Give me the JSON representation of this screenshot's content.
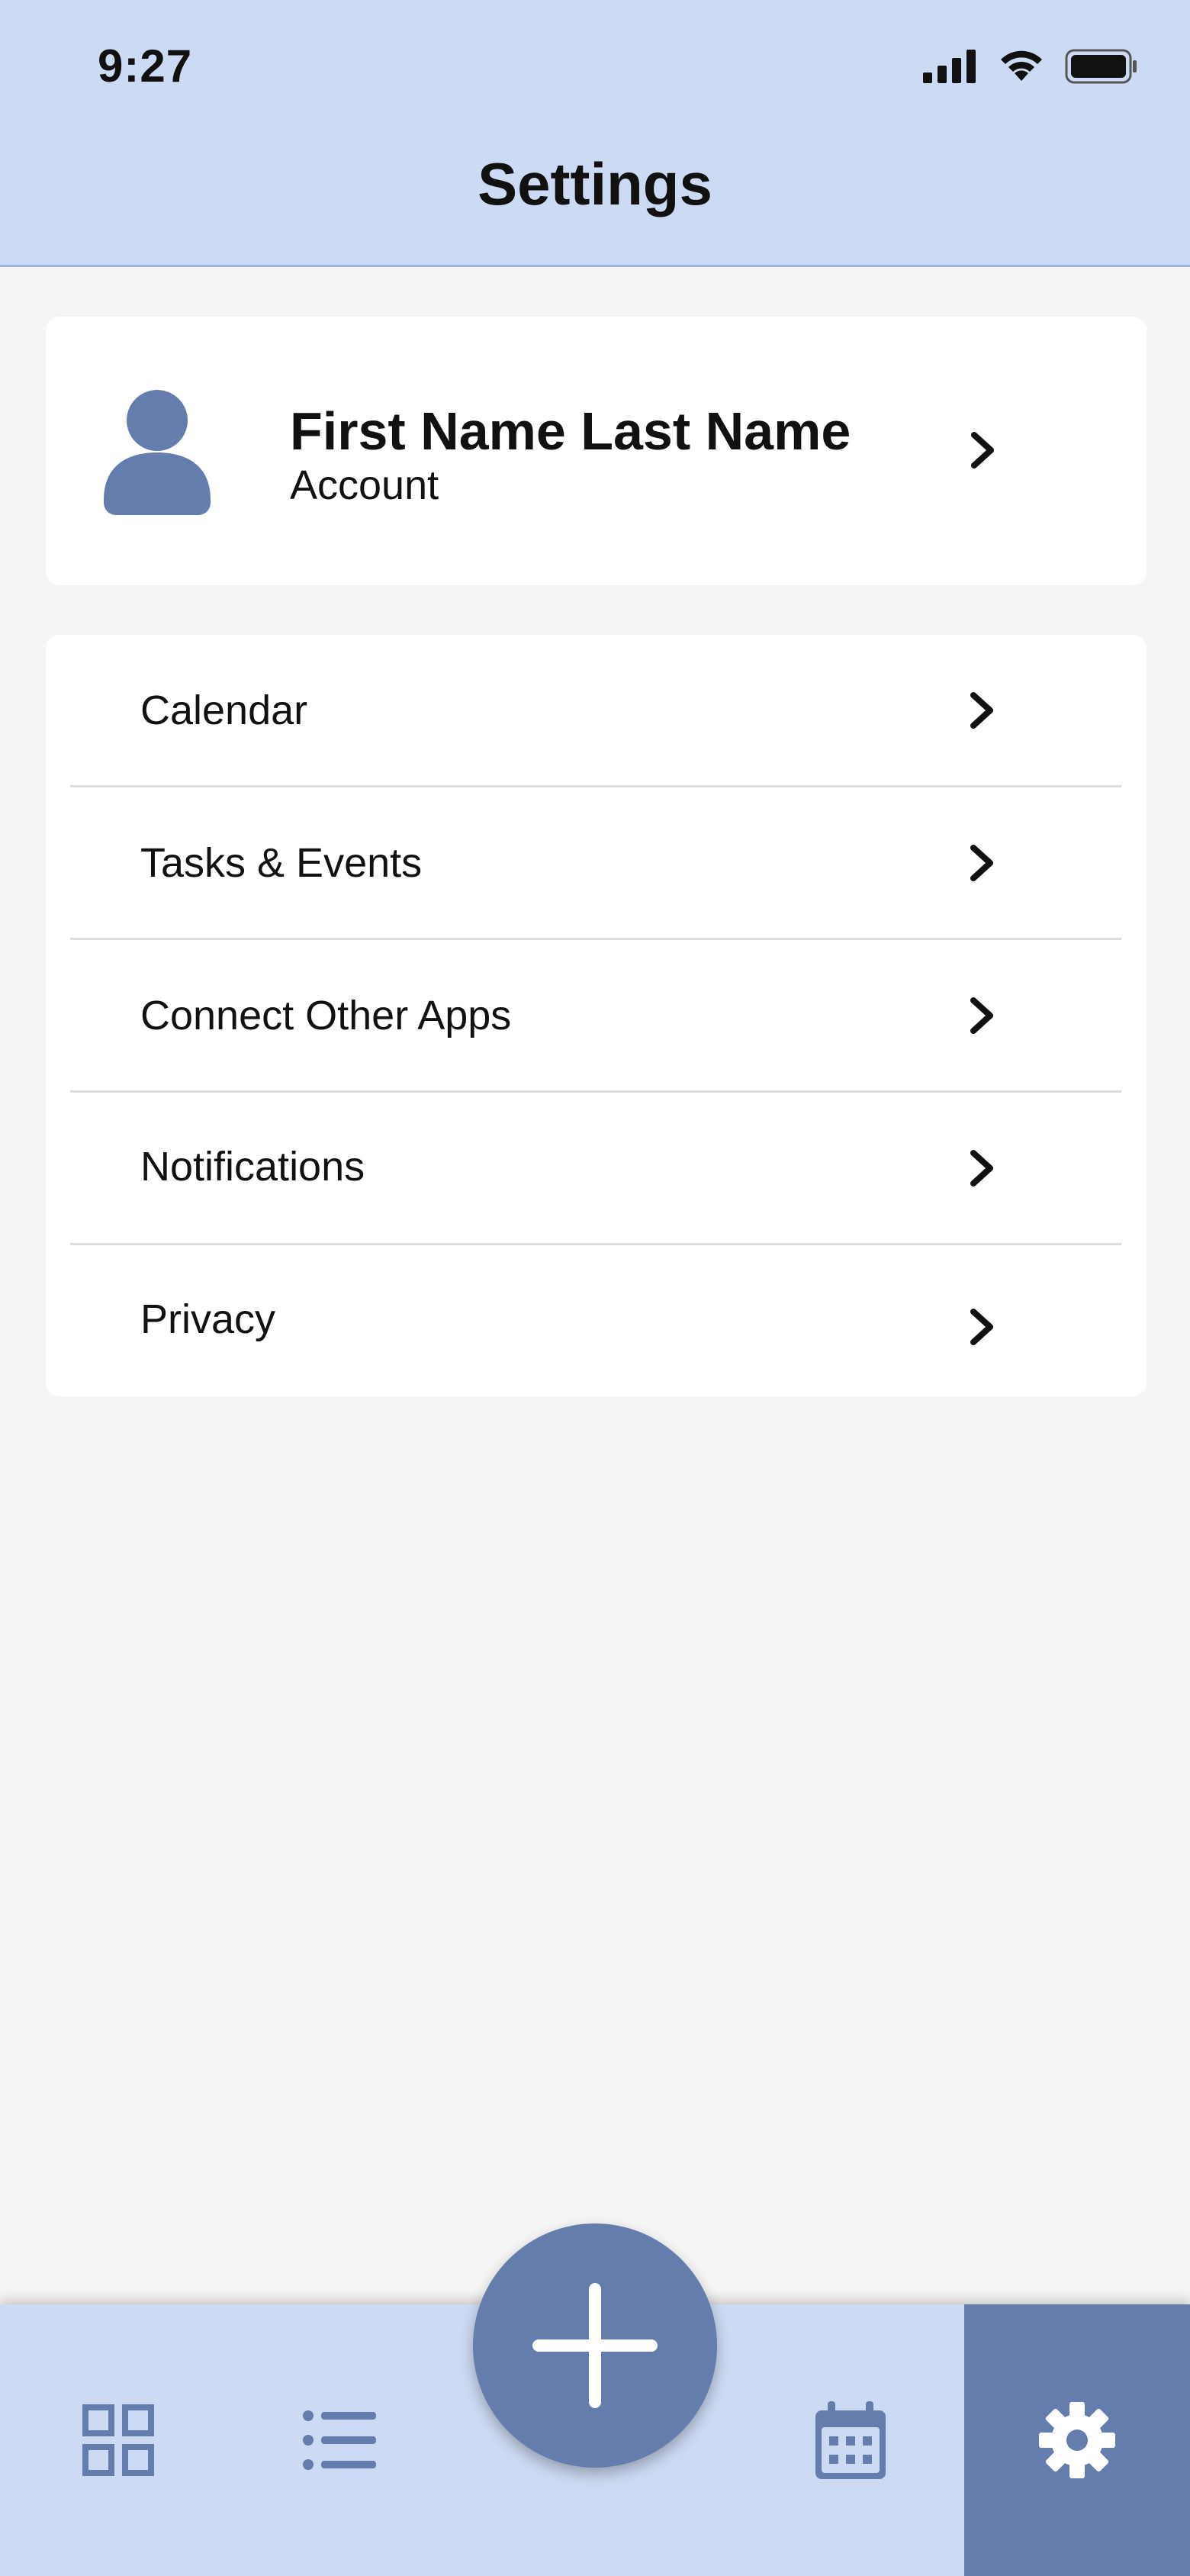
{
  "status_bar": {
    "time": "9:27"
  },
  "header": {
    "title": "Settings"
  },
  "profile": {
    "name": "First Name Last Name",
    "subtitle": "Account"
  },
  "menu": {
    "items": [
      {
        "label": "Calendar"
      },
      {
        "label": "Tasks & Events"
      },
      {
        "label": "Connect Other Apps"
      },
      {
        "label": "Notifications"
      },
      {
        "label": "Privacy"
      }
    ]
  },
  "bottom_nav": {
    "items": [
      {
        "icon": "grid-icon"
      },
      {
        "icon": "list-icon"
      },
      {
        "icon": "plus-icon"
      },
      {
        "icon": "calendar-icon"
      },
      {
        "icon": "gear-icon",
        "active": true
      }
    ]
  },
  "colors": {
    "header_bg": "#cddaf3",
    "accent": "#647dad",
    "page_bg": "#f5f5f5"
  }
}
